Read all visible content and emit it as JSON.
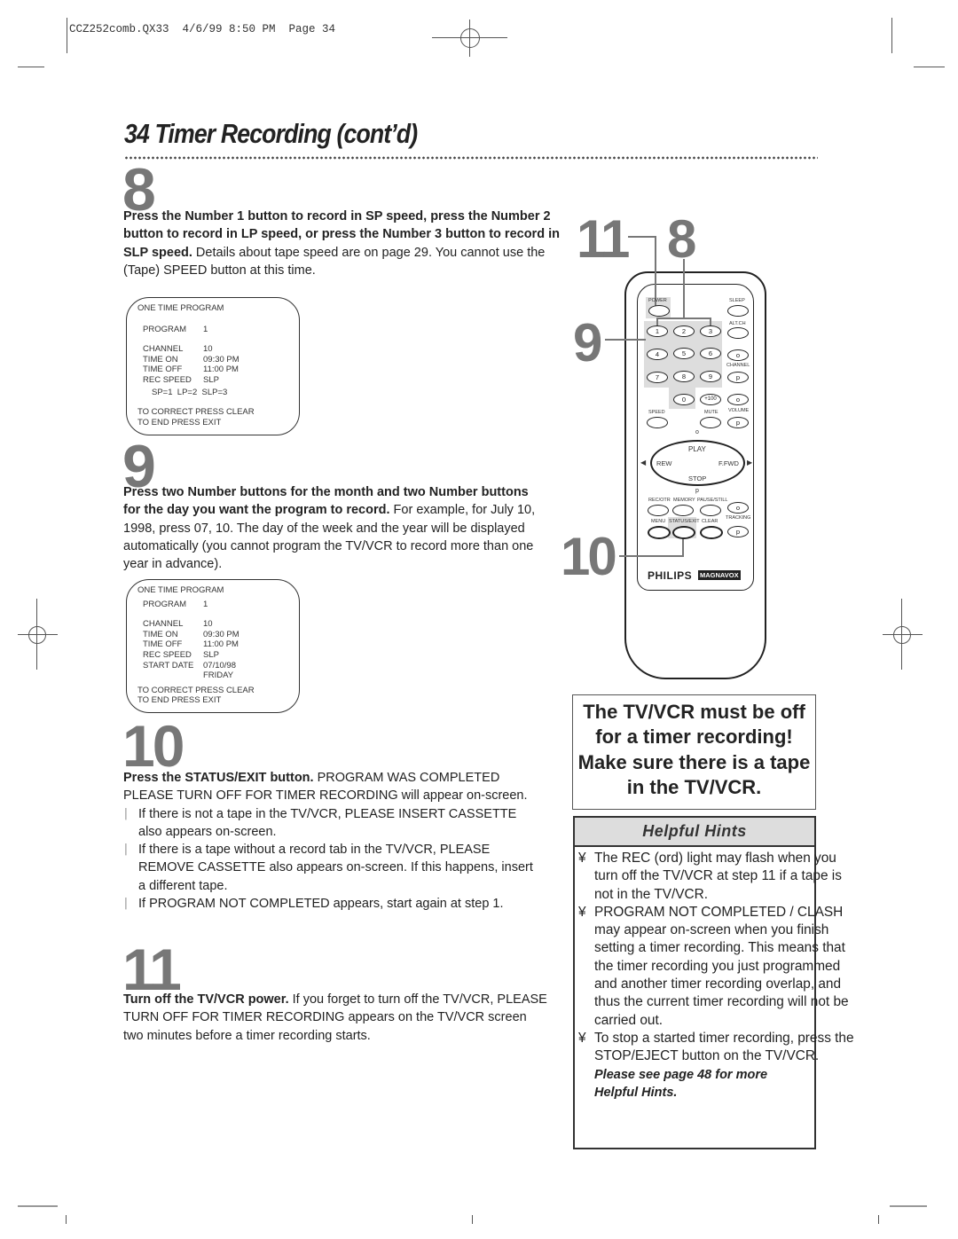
{
  "slug": "CCZ252comb.QX33  4/6/99 8:50 PM  Page 34",
  "page_title": "34  Timer Recording (cont’d)",
  "steps": {
    "s8": {
      "number": "8",
      "bold": "Press the Number 1 button to record in SP speed, press the Number 2 button to record in LP speed, or press the Number 3 button to record in SLP speed.",
      "text": " Details about tape speed are on page 29. You cannot use the (Tape) SPEED button at this time.",
      "osd": {
        "header": "ONE TIME PROGRAM",
        "rows": [
          {
            "k": "PROGRAM",
            "v": "1"
          },
          {
            "k": "CHANNEL",
            "v": "10"
          },
          {
            "k": "TIME ON",
            "v": "09:30 PM"
          },
          {
            "k": "TIME OFF",
            "v": "11:00 PM"
          },
          {
            "k": "REC SPEED",
            "v": "SLP"
          }
        ],
        "speed_hint": "SP=1  LP=2  SLP=3",
        "footer1": "TO CORRECT PRESS CLEAR",
        "footer2": "TO END PRESS EXIT"
      }
    },
    "s9": {
      "number": "9",
      "bold": "Press two Number buttons for the month and two Number buttons for the day you want the program to record.",
      "text": "  For example, for July 10, 1998, press 07, 10. The day of the week and the year will be displayed automatically (you cannot program the TV/VCR to record more than one year in advance).",
      "osd": {
        "header": "ONE TIME PROGRAM",
        "rows": [
          {
            "k": "PROGRAM",
            "v": "1"
          },
          {
            "k": "CHANNEL",
            "v": "10"
          },
          {
            "k": "TIME ON",
            "v": "09:30 PM"
          },
          {
            "k": "TIME OFF",
            "v": "11:00 PM"
          },
          {
            "k": "REC SPEED",
            "v": "SLP"
          },
          {
            "k": "START DATE",
            "v": "07/10/98"
          },
          {
            "k": "",
            "v": "FRIDAY"
          }
        ],
        "footer1": "TO CORRECT PRESS CLEAR",
        "footer2": "TO END PRESS EXIT"
      }
    },
    "s10": {
      "number": "10",
      "bold": "Press the STATUS/EXIT button.",
      "text": " PROGRAM WAS COMPLETED PLEASE TURN OFF FOR TIMER RECORDING will appear on-screen.",
      "bullets": [
        "If there is not a tape in the TV/VCR, PLEASE INSERT CASSETTE also appears on-screen.",
        "If there is a tape without a record tab in the TV/VCR, PLEASE REMOVE CASSETTE also appears on-screen. If this happens, insert a different tape.",
        "If PROGRAM NOT COMPLETED appears, start again at step 1."
      ]
    },
    "s11": {
      "number": "11",
      "bold": "Turn off the TV/VCR power.",
      "text": " If you forget to turn off the TV/VCR, PLEASE TURN OFF FOR TIMER RECORDING appears on the TV/VCR screen two minutes before a timer recording starts."
    }
  },
  "remote": {
    "callouts": {
      "c11": "11",
      "c8": "8",
      "c9": "9",
      "c10": "10"
    },
    "labels": {
      "power": "POWER",
      "sleep": "SLEEP",
      "altch": "ALT.CH",
      "channel": "CHANNEL",
      "speed": "SPEED",
      "mute": "MUTE",
      "volume": "VOLUME",
      "play": "PLAY",
      "rew": "REW",
      "ffwd": "F.FWD",
      "stop": "STOP",
      "recotr": "REC/OTR",
      "memory": "MEMORY",
      "pausestill": "PAUSE/STILL",
      "menu": "MENU",
      "statusexit": "STATUS/EXIT",
      "clear": "CLEAR",
      "tracking": "TRACKING",
      "up": "o",
      "down": "p"
    },
    "keys": [
      "1",
      "2",
      "3",
      "4",
      "5",
      "6",
      "7",
      "8",
      "9",
      "0",
      "+100"
    ],
    "brand1": "PHILIPS",
    "brand2": "MAGNAVOX"
  },
  "warning": "The TV/VCR must be off for a timer recording! Make sure there is a tape in the TV/VCR.",
  "hints": {
    "title": "Helpful Hints",
    "bullet": "¥",
    "items": [
      "The REC (ord) light may flash when you turn off the TV/VCR at step 11 if a tape is not in the TV/VCR.",
      "PROGRAM NOT COMPLETED / CLASH may appear on-screen when you finish setting a timer recording. This means that the timer recording you just programmed and another timer recording overlap, and thus the current timer recording will not be carried out.",
      "To stop a started timer recording, press the STOP/EJECT button on the TV/VCR."
    ],
    "footer": "Please see page 48 for more Helpful Hints."
  }
}
